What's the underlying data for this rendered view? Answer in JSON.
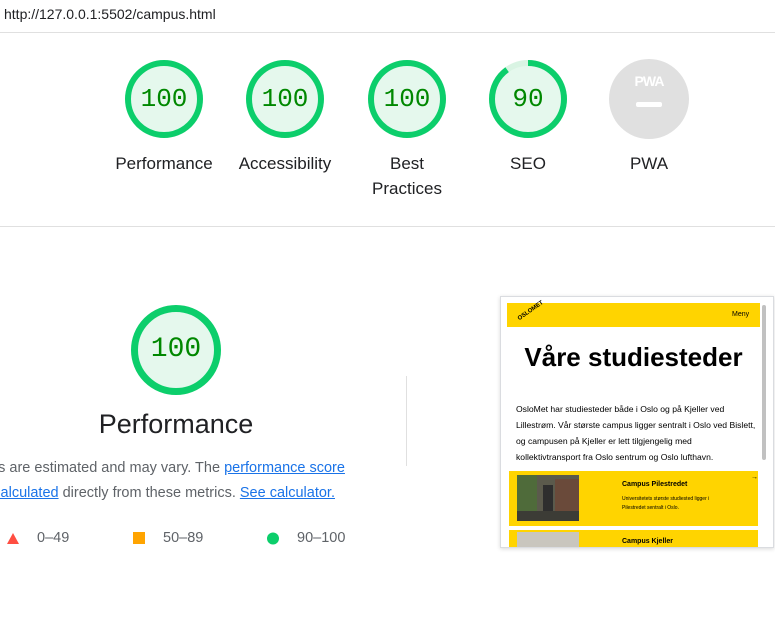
{
  "browser": {
    "url": "http://127.0.0.1:5502/campus.html"
  },
  "gauges": [
    {
      "score": "100",
      "label_line1": "Performance",
      "label_line2": "",
      "fraction": 1.0,
      "color": "#0cce6b"
    },
    {
      "score": "100",
      "label_line1": "Accessibility",
      "label_line2": "",
      "fraction": 1.0,
      "color": "#0cce6b"
    },
    {
      "score": "100",
      "label_line1": "Best",
      "label_line2": "Practices",
      "fraction": 1.0,
      "color": "#0cce6b"
    },
    {
      "score": "90",
      "label_line1": "SEO",
      "label_line2": "",
      "fraction": 0.9,
      "color": "#0cce6b"
    }
  ],
  "pwa": {
    "logo": "PWA",
    "label": "PWA"
  },
  "detail": {
    "score": "100",
    "title": "Performance",
    "desc_part1": "ues are estimated and may vary. The ",
    "link1": "performance score",
    "link2": "s calculated",
    "desc_part2": " directly from these metrics. ",
    "link3": "See calculator."
  },
  "legend": [
    {
      "range": "0–49",
      "shape": "triangle",
      "color": "#ff4e42"
    },
    {
      "range": "50–89",
      "shape": "square",
      "color": "#ffa400"
    },
    {
      "range": "90–100",
      "shape": "circle",
      "color": "#0cce6b"
    }
  ],
  "screenshot": {
    "logo": "OSLOMET",
    "menu": "Meny",
    "title": "Våre studiesteder",
    "paragraph": "OsloMet har studiesteder både i Oslo og på Kjeller ved Lillestrøm. Vår største campus ligger sentralt i Oslo ved Bislett, og campusen på Kjeller er lett tilgjengelig med kollektivtransport fra Oslo sentrum og Oslo lufthavn.",
    "cards": [
      {
        "title": "Campus Pilestredet",
        "text": "Universitetets største studiested ligger i Pilestredet sentralt i Oslo.",
        "arrow": "→"
      },
      {
        "title": "Campus Kjeller",
        "text": "",
        "arrow": ""
      }
    ]
  },
  "colors": {
    "pass": "#0cce6b",
    "pass_bg": "#e5f8ed",
    "pass_text": "#008800",
    "link": "#1a73e8",
    "accent_yellow": "#ffd400"
  }
}
